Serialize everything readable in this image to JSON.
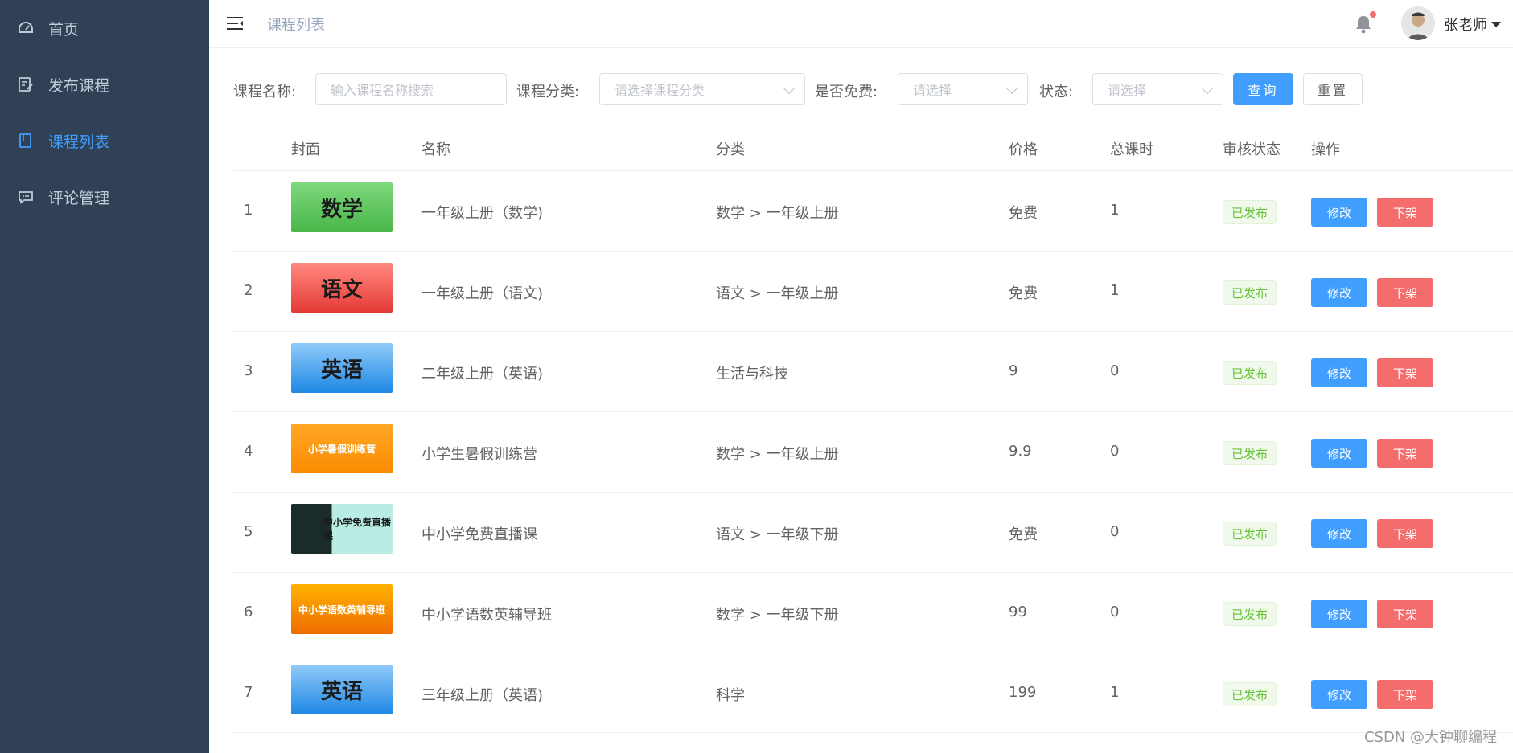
{
  "sidebar": {
    "items": [
      {
        "label": "首页",
        "icon": "dashboard-icon"
      },
      {
        "label": "发布课程",
        "icon": "edit-icon"
      },
      {
        "label": "课程列表",
        "icon": "document-icon"
      },
      {
        "label": "评论管理",
        "icon": "comment-icon"
      }
    ],
    "active_index": 2,
    "bg_color": "#304156",
    "active_color": "#409eff"
  },
  "header": {
    "breadcrumb": "课程列表",
    "username": "张老师",
    "has_notification": true
  },
  "filters": {
    "name_label": "课程名称:",
    "name_placeholder": "输入课程名称搜索",
    "category_label": "课程分类:",
    "category_placeholder": "请选择课程分类",
    "free_label": "是否免费:",
    "free_placeholder": "请选择",
    "status_label": "状态:",
    "status_placeholder": "请选择",
    "query_button": "查询",
    "reset_button": "重置"
  },
  "table": {
    "headers": {
      "cover": "封面",
      "name": "名称",
      "category": "分类",
      "price": "价格",
      "hours": "总课时",
      "status": "审核状态",
      "actions": "操作"
    },
    "rows": [
      {
        "index": "1",
        "cover_text": "数学",
        "name": "一年级上册（数学)",
        "category": "数学 > 一年级上册",
        "price": "免费",
        "hours": "1",
        "status": "已发布"
      },
      {
        "index": "2",
        "cover_text": "语文",
        "name": "一年级上册（语文)",
        "category": "语文 > 一年级上册",
        "price": "免费",
        "hours": "1",
        "status": "已发布"
      },
      {
        "index": "3",
        "cover_text": "英语",
        "name": "二年级上册（英语)",
        "category": "生活与科技",
        "price": "9",
        "hours": "0",
        "status": "已发布"
      },
      {
        "index": "4",
        "cover_text": "小学暑假训练营",
        "name": "小学生暑假训练营",
        "category": "数学 > 一年级上册",
        "price": "9.9",
        "hours": "0",
        "status": "已发布"
      },
      {
        "index": "5",
        "cover_text": "中小学免费直播课",
        "name": "中小学免费直播课",
        "category": "语文 > 一年级下册",
        "price": "免费",
        "hours": "0",
        "status": "已发布"
      },
      {
        "index": "6",
        "cover_text": "中小学语数英辅导班",
        "name": "中小学语数英辅导班",
        "category": "数学 > 一年级下册",
        "price": "99",
        "hours": "0",
        "status": "已发布"
      },
      {
        "index": "7",
        "cover_text": "英语",
        "name": "三年级上册（英语)",
        "category": "科学",
        "price": "199",
        "hours": "1",
        "status": "已发布"
      }
    ],
    "edit_label": "修改",
    "offline_label": "下架"
  },
  "watermark": "CSDN @大钟聊编程"
}
